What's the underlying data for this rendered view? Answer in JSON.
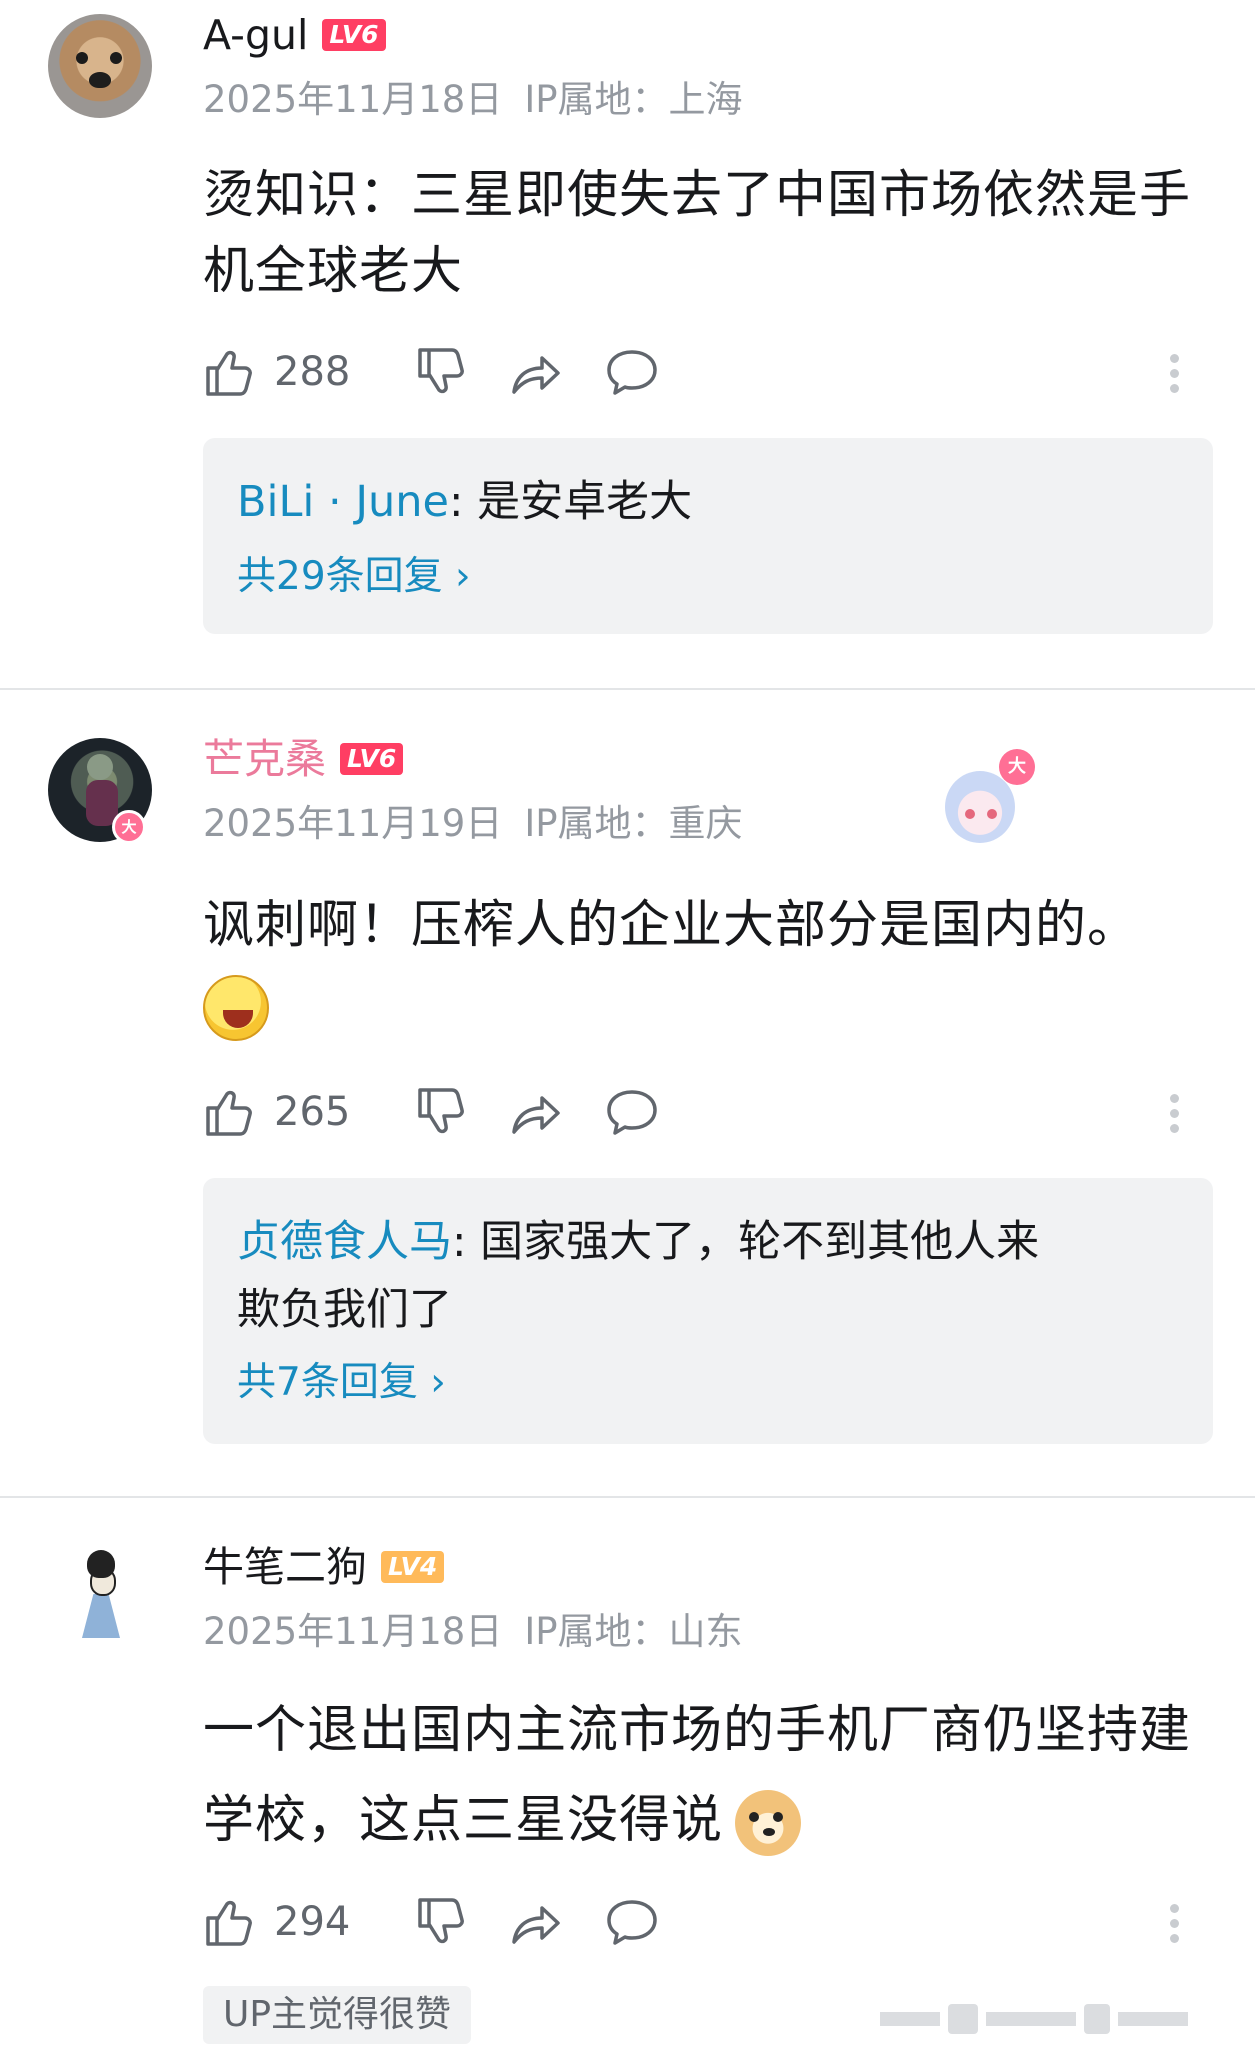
{
  "comments": [
    {
      "username": "A-gul",
      "level": "LV6",
      "date": "2025年11月18日",
      "ip": "IP属地：上海",
      "text_lines": [
        "烫知识：三星即使失去了中国市场依然是手",
        "机全球老大"
      ],
      "likes": "288",
      "reply": {
        "author": "BiLi · June",
        "text": ": 是安卓老大",
        "more": "共29条回复 ›"
      }
    },
    {
      "username": "芒克桑",
      "level": "LV6",
      "date": "2025年11月19日",
      "ip": "IP属地：重庆",
      "text_lines": [
        "讽刺啊！压榨人的企业大部分是国内的。"
      ],
      "likes": "265",
      "avatar_badge": "大",
      "deco_badge": "大",
      "reply": {
        "author": "贞德食人马",
        "text_line1": ": 国家强大了，轮不到其他人来",
        "text_line2": "欺负我们了",
        "more": "共7条回复 ›"
      }
    },
    {
      "username": "牛笔二狗",
      "level": "LV4",
      "date": "2025年11月18日",
      "ip": "IP属地：山东",
      "text_lines": [
        "一个退出国内主流市场的手机厂商仍坚持建",
        "学校，这点三星没得说"
      ],
      "likes": "294"
    }
  ],
  "up_tag": "UP主觉得很赞",
  "colors": {
    "link_blue": "#178bbf",
    "vip_pink": "#eb7a9b",
    "lv6_red": "#ff3e63",
    "lv4_orange": "#ffba5a",
    "meta_gray": "#9499a0"
  },
  "icons": [
    "like-icon",
    "dislike-icon",
    "share-icon",
    "reply-icon",
    "more-icon"
  ]
}
